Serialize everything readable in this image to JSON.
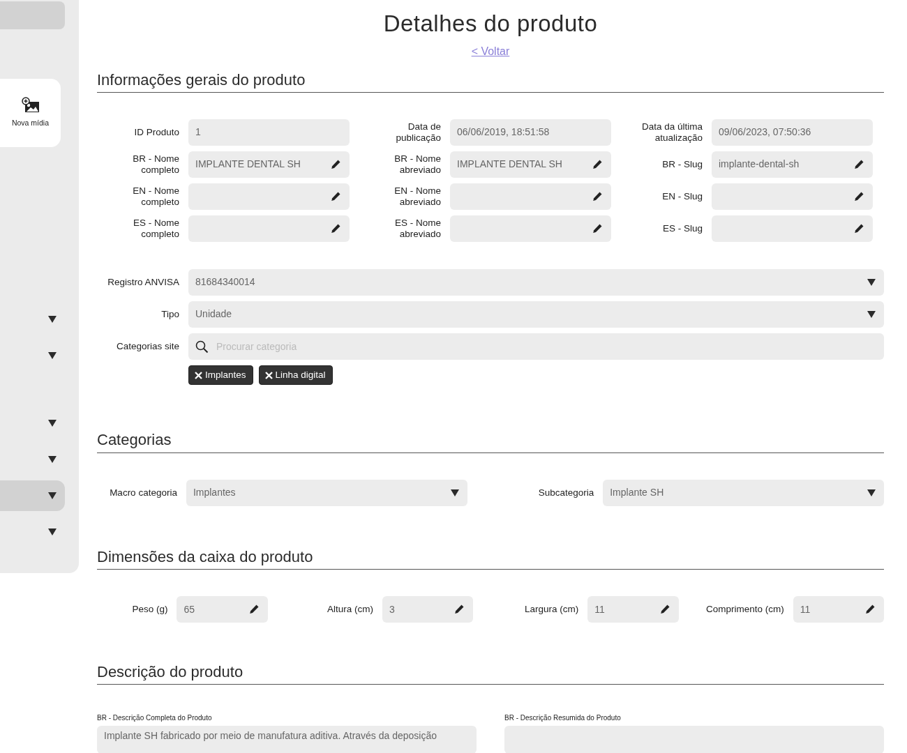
{
  "sidebar": {
    "top_item": {
      "selected": true
    },
    "new_media_button": {
      "label": "Nova mídia"
    },
    "items": [
      {
        "kind": "dropdown",
        "selected": false
      },
      {
        "kind": "dropdown",
        "selected": false
      },
      {
        "kind": "dropdown",
        "selected": false
      },
      {
        "kind": "dropdown",
        "selected": false
      },
      {
        "kind": "dropdown",
        "selected": true
      },
      {
        "kind": "dropdown",
        "selected": false
      }
    ]
  },
  "page": {
    "title": "Detalhes do produto",
    "back_link": "< Voltar"
  },
  "general": {
    "title": "Informações gerais do produto",
    "fields": [
      {
        "label": "ID Produto",
        "value": "1",
        "kind": "readonly"
      },
      {
        "label": "Data de publicação",
        "value": "06/06/2019, 18:51:58",
        "kind": "readonly"
      },
      {
        "label": "Data da última atualização",
        "value": "09/06/2023, 07:50:36",
        "kind": "readonly"
      },
      {
        "label": "BR - Nome completo",
        "value": "IMPLANTE DENTAL SH",
        "kind": "editable"
      },
      {
        "label": "BR - Nome abreviado",
        "value": "IMPLANTE DENTAL SH",
        "kind": "editable"
      },
      {
        "label": "BR - Slug",
        "value": "implante-dental-sh",
        "kind": "editable"
      },
      {
        "label": "EN - Nome completo",
        "kind": "editable"
      },
      {
        "label": "EN - Nome abreviado",
        "kind": "editable"
      },
      {
        "label": "EN - Slug",
        "kind": "editable"
      },
      {
        "label": "ES - Nome completo",
        "kind": "editable"
      },
      {
        "label": "ES - Nome abreviado",
        "kind": "editable"
      },
      {
        "label": "ES - Slug",
        "kind": "editable"
      }
    ],
    "wide_fields": [
      {
        "label": "Registro ANVISA",
        "value": "81684340014",
        "kind": "select"
      },
      {
        "label": "Tipo",
        "value": "Unidade",
        "kind": "select"
      },
      {
        "label": "Categorias site",
        "placeholder": "Procurar categoria",
        "kind": "search"
      }
    ],
    "tags": [
      {
        "label": "Implantes"
      },
      {
        "label": "Linha digital"
      }
    ]
  },
  "categories": {
    "title": "Categorias",
    "fields": [
      {
        "label": "Macro categoria",
        "value": "Implantes",
        "kind": "select"
      },
      {
        "label": "Subcategoria",
        "value": "Implante SH",
        "kind": "select"
      }
    ]
  },
  "dimensions": {
    "title": "Dimensões da caixa do produto",
    "fields": [
      {
        "label": "Peso (g)",
        "value": "65",
        "kind": "editable"
      },
      {
        "label": "Altura (cm)",
        "value": "3",
        "kind": "editable"
      },
      {
        "label": "Largura (cm)",
        "value": "11",
        "kind": "editable"
      },
      {
        "label": "Comprimento (cm)",
        "value": "11",
        "kind": "editable"
      }
    ]
  },
  "description": {
    "title": "Descrição do produto",
    "fields": [
      {
        "label": "BR - Descrição Completa do Produto",
        "value": "Implante SH fabricado por meio de manufatura aditiva. Através da deposição",
        "kind": "textarea"
      },
      {
        "label": "BR - Descrição Resumida do Produto",
        "kind": "textarea"
      }
    ]
  }
}
